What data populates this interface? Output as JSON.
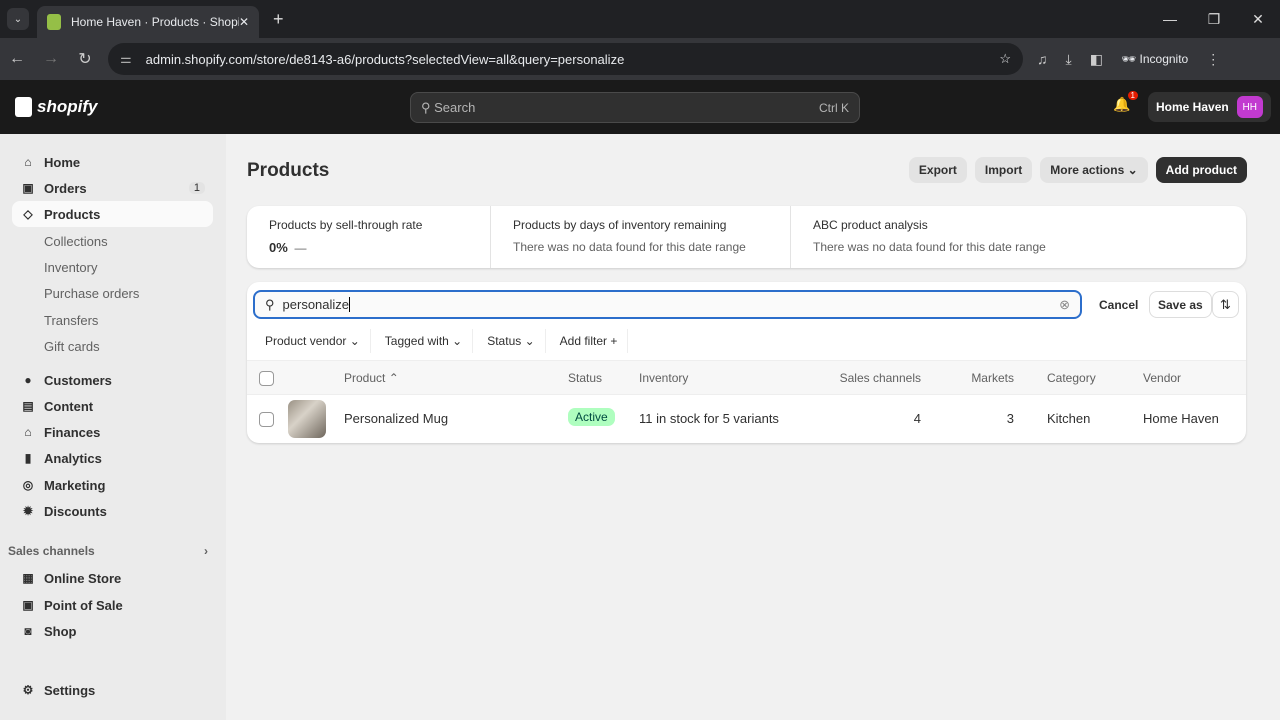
{
  "browser": {
    "tab_title": "Home Haven · Products · Shopify",
    "url": "admin.shopify.com/store/de8143-a6/products?selectedView=all&query=personalize",
    "incognito": "Incognito"
  },
  "topbar": {
    "logo": "shopify",
    "search_placeholder": "Search",
    "search_shortcut": "Ctrl K",
    "notifications": "1",
    "store_name": "Home Haven",
    "avatar": "HH"
  },
  "sidebar": {
    "items": [
      {
        "label": "Home",
        "icon": "home-icon"
      },
      {
        "label": "Orders",
        "icon": "inbox-icon",
        "badge": "1"
      },
      {
        "label": "Products",
        "icon": "tag-icon",
        "active": true
      },
      {
        "label": "Collections"
      },
      {
        "label": "Inventory"
      },
      {
        "label": "Purchase orders"
      },
      {
        "label": "Transfers"
      },
      {
        "label": "Gift cards"
      },
      {
        "label": "Customers",
        "icon": "person-icon"
      },
      {
        "label": "Content",
        "icon": "content-icon"
      },
      {
        "label": "Finances",
        "icon": "bank-icon"
      },
      {
        "label": "Analytics",
        "icon": "bar-chart-icon"
      },
      {
        "label": "Marketing",
        "icon": "target-icon"
      },
      {
        "label": "Discounts",
        "icon": "discount-icon"
      }
    ],
    "sales_channels": "Sales channels",
    "channels": [
      {
        "label": "Online Store"
      },
      {
        "label": "Point of Sale"
      },
      {
        "label": "Shop"
      }
    ],
    "settings": "Settings"
  },
  "page": {
    "title": "Products",
    "export": "Export",
    "import": "Import",
    "more_actions": "More actions",
    "add_product": "Add product"
  },
  "metrics": [
    {
      "label": "Products by sell-through rate",
      "value": "0%",
      "trend": "—"
    },
    {
      "label": "Products by days of inventory remaining",
      "value": "There was no data found for this date range"
    },
    {
      "label": "ABC product analysis",
      "value": "There was no data found for this date range"
    }
  ],
  "list": {
    "query": "personalize",
    "cancel": "Cancel",
    "save_as": "Save as",
    "filters": [
      "Product vendor",
      "Tagged with",
      "Status",
      "Add filter +"
    ],
    "columns": [
      "Product",
      "Status",
      "Inventory",
      "Sales channels",
      "Markets",
      "Category",
      "Vendor"
    ],
    "rows": [
      {
        "product": "Personalized Mug",
        "status": "Active",
        "inventory": "11 in stock for 5 variants",
        "sales_channels": "4",
        "markets": "3",
        "category": "Kitchen",
        "vendor": "Home Haven"
      }
    ]
  },
  "colors": {
    "accent": "#2c6ecb",
    "active_badge": "#affebf"
  }
}
